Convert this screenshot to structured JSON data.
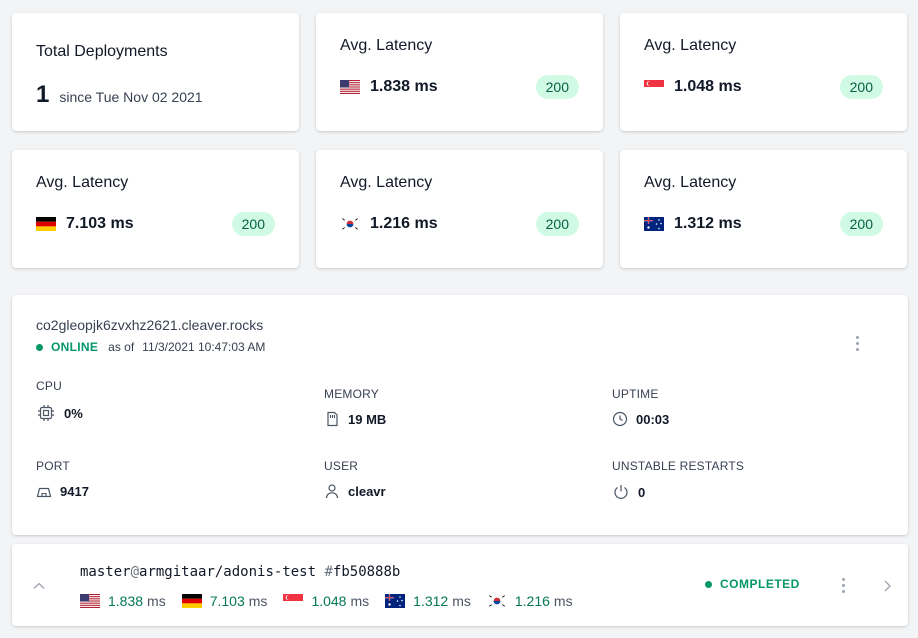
{
  "total_deployments": {
    "title": "Total Deployments",
    "count": "1",
    "since": "since Tue Nov 02 2021"
  },
  "latency_cards": [
    {
      "title": "Avg. Latency",
      "flag": "us-flag-icon",
      "value": "1.838 ms",
      "status": "200"
    },
    {
      "title": "Avg. Latency",
      "flag": "sg-flag-icon",
      "value": "1.048 ms",
      "status": "200"
    },
    {
      "title": "Avg. Latency",
      "flag": "de-flag-icon",
      "value": "7.103 ms",
      "status": "200"
    },
    {
      "title": "Avg. Latency",
      "flag": "kr-flag-icon",
      "value": "1.216 ms",
      "status": "200"
    },
    {
      "title": "Avg. Latency",
      "flag": "au-flag-icon",
      "value": "1.312 ms",
      "status": "200"
    }
  ],
  "server": {
    "host": "co2gleopjk6zvxhz2621.cleaver.rocks",
    "status": "ONLINE",
    "as_of_label": "as of",
    "as_of_time": "11/3/2021 10:47:03 AM",
    "metrics": {
      "cpu": {
        "label": "CPU",
        "value": "0%",
        "icon": "cpu-icon"
      },
      "memory": {
        "label": "MEMORY",
        "value": "19 MB",
        "icon": "memory-card-icon"
      },
      "uptime": {
        "label": "UPTIME",
        "value": "00:03",
        "icon": "clock-icon"
      },
      "port": {
        "label": "PORT",
        "value": "9417",
        "icon": "port-icon"
      },
      "user": {
        "label": "USER",
        "value": "cleavr",
        "icon": "user-icon"
      },
      "unstable_restarts": {
        "label": "UNSTABLE RESTARTS",
        "value": "0",
        "icon": "power-icon"
      }
    }
  },
  "deployment": {
    "branch": "master",
    "at": "@",
    "repo": "armgitaar/adonis-test",
    "hash_sign": "#",
    "commit": "fb50888b",
    "latencies": [
      {
        "flag": "us-flag-icon",
        "value": "1.838",
        "unit": "ms"
      },
      {
        "flag": "de-flag-icon",
        "value": "7.103",
        "unit": "ms"
      },
      {
        "flag": "sg-flag-icon",
        "value": "1.048",
        "unit": "ms"
      },
      {
        "flag": "au-flag-icon",
        "value": "1.312",
        "unit": "ms"
      },
      {
        "flag": "kr-flag-icon",
        "value": "1.216",
        "unit": "ms"
      }
    ],
    "status": "COMPLETED"
  },
  "colors": {
    "success": "#059669",
    "badge_bg": "#d1fae5",
    "badge_text": "#065f46",
    "page_bg": "#f3f4f6"
  }
}
